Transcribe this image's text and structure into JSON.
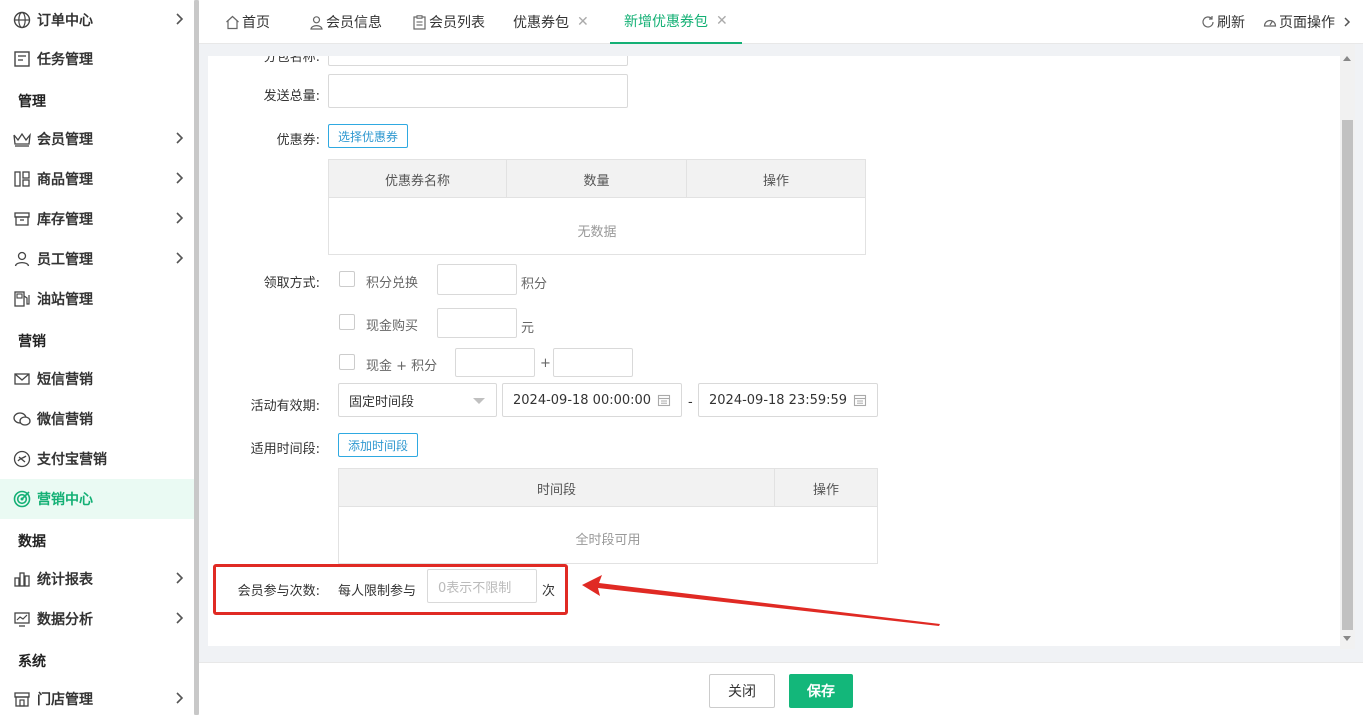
{
  "sidebar": {
    "items": [
      {
        "label": "订单中心",
        "icon": "globe-icon",
        "has_arrow": true
      },
      {
        "label": "任务管理",
        "icon": "task-icon",
        "has_arrow": false
      },
      {
        "label": "会员管理",
        "icon": "crown-icon",
        "has_arrow": true
      },
      {
        "label": "商品管理",
        "icon": "goods-icon",
        "has_arrow": true
      },
      {
        "label": "库存管理",
        "icon": "box-icon",
        "has_arrow": true
      },
      {
        "label": "员工管理",
        "icon": "user-icon",
        "has_arrow": true
      },
      {
        "label": "油站管理",
        "icon": "fuel-station-icon",
        "has_arrow": false
      },
      {
        "label": "短信营销",
        "icon": "mail-icon",
        "has_arrow": false
      },
      {
        "label": "微信营销",
        "icon": "wechat-icon",
        "has_arrow": false
      },
      {
        "label": "支付宝营销",
        "icon": "alipay-icon",
        "has_arrow": false
      },
      {
        "label": "营销中心",
        "icon": "target-icon",
        "has_arrow": false,
        "active": true
      },
      {
        "label": "统计报表",
        "icon": "bar-chart-icon",
        "has_arrow": true
      },
      {
        "label": "数据分析",
        "icon": "monitor-chart-icon",
        "has_arrow": true
      },
      {
        "label": "门店管理",
        "icon": "store-icon",
        "has_arrow": true
      }
    ],
    "groups": [
      "管理",
      "营销",
      "数据",
      "系统"
    ]
  },
  "tabs": [
    {
      "label": "首页",
      "icon": "home-icon",
      "closable": false
    },
    {
      "label": "会员信息",
      "icon": "user-icon",
      "closable": false
    },
    {
      "label": "会员列表",
      "icon": "clipboard-icon",
      "closable": false
    },
    {
      "label": "优惠券包",
      "closable": true
    },
    {
      "label": "新增优惠券包",
      "closable": true,
      "active": true
    }
  ],
  "toolbar": {
    "refresh": "刷新",
    "page_ops": "页面操作"
  },
  "form": {
    "partial_label": "分包名称:",
    "total_label": "发送总量:",
    "coupon_label": "优惠券:",
    "select_coupon_btn": "选择优惠券",
    "coupon_table": {
      "headers": [
        "优惠券名称",
        "数量",
        "操作"
      ],
      "empty": "无数据"
    },
    "receive_label": "领取方式:",
    "opt_points": "积分兑换",
    "unit_points": "积分",
    "opt_cash": "现金购买",
    "unit_yuan": "元",
    "opt_cash_points": "现金 + 积分",
    "plus": "+",
    "validity_label": "活动有效期:",
    "validity_type": "固定时间段",
    "start_time": "2024-09-18 00:00:00",
    "dash": "-",
    "end_time": "2024-09-18 23:59:59",
    "period_label": "适用时间段:",
    "add_period_btn": "添加时间段",
    "period_table": {
      "headers": [
        "时间段",
        "操作"
      ],
      "empty": "全时段可用"
    },
    "count_label": "会员参与次数:",
    "per_person": "每人限制参与",
    "count_placeholder": "0表示不限制",
    "times_unit": "次"
  },
  "footer": {
    "close": "关闭",
    "save": "保存"
  },
  "colors": {
    "accent": "#14b075",
    "highlight_red": "#e02a24",
    "link_blue": "#2f98d0"
  }
}
